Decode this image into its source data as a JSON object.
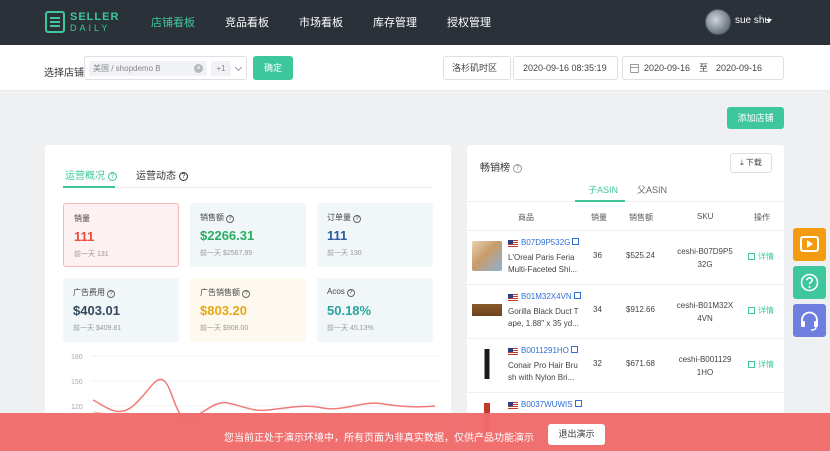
{
  "brand": {
    "line1": "SELLER",
    "line2": "DAILY"
  },
  "nav": {
    "items": [
      {
        "label": "店铺看板",
        "active": true
      },
      {
        "label": "竞品看板",
        "active": false
      },
      {
        "label": "市场看板",
        "active": false
      },
      {
        "label": "库存管理",
        "active": false
      },
      {
        "label": "授权管理",
        "active": false
      }
    ],
    "user": "sue shu"
  },
  "filters": {
    "shop_label": "选择店铺:",
    "shop_tag": "美国 / shopdemo B",
    "shop_more": "+1",
    "confirm": "确定",
    "timezone": "洛杉矶时区",
    "datetime": "2020-09-16 08:35:19",
    "range_from": "2020-09-16",
    "range_sep": "至",
    "range_to": "2020-09-16"
  },
  "add_shop": "添加店铺",
  "overview": {
    "tabs": [
      {
        "label": "运营概况"
      },
      {
        "label": "运营动态"
      }
    ],
    "stats": [
      {
        "label": "销量",
        "value": "111",
        "prev": "前一天 131",
        "color": "#e74c3c"
      },
      {
        "label": "销售额",
        "value": "$2266.31",
        "prev": "前一天 $2567.99",
        "color": "#27ae60"
      },
      {
        "label": "订单量",
        "value": "111",
        "prev": "前一天 130",
        "color": "#2c5aa0"
      },
      {
        "label": "广告费用",
        "value": "$403.01",
        "prev": "前一天 $409.81",
        "color": "#34495e"
      },
      {
        "label": "广告销售额",
        "value": "$803.20",
        "prev": "前一天 $908.00",
        "color": "#e6a817"
      },
      {
        "label": "Acos",
        "value": "50.18%",
        "prev": "前一天 45.13%",
        "color": "#2aa5a0"
      }
    ],
    "chart_y_ticks": [
      "180",
      "150",
      "120"
    ]
  },
  "bestsellers": {
    "title": "畅销榜",
    "download": "下载",
    "subtabs": [
      {
        "label": "子ASIN"
      },
      {
        "label": "父ASIN"
      }
    ],
    "columns": [
      "商品",
      "销量",
      "销售额",
      "SKU",
      "操作"
    ],
    "rows": [
      {
        "asin": "B07D9P532G",
        "title": "L'Oreal Paris Feria Multi-Faceted Shi...",
        "qty": "36",
        "sales": "$525.24",
        "sku": "ceshi-B07D9P5 32G",
        "op": "详情"
      },
      {
        "asin": "B01M32X4VN",
        "title": "Gorilla Black Duct T ape, 1.88\" x 35 yd...",
        "qty": "34",
        "sales": "$912.66",
        "sku": "ceshi-B01M32X 4VN",
        "op": "详情"
      },
      {
        "asin": "B0011291HO",
        "title": "Conair Pro Hair Bru sh with Nylon Bri...",
        "qty": "32",
        "sales": "$671.68",
        "sku": "ceshi-B001129 1HO",
        "op": "详情"
      },
      {
        "asin": "B0037WUWIS",
        "title": "",
        "qty": "",
        "sales": "",
        "sku": "",
        "op": ""
      }
    ]
  },
  "banner": {
    "text": "您当前正处于演示环境中，所有页面为非真实数据，仅供产品功能演示",
    "exit": "退出演示"
  }
}
